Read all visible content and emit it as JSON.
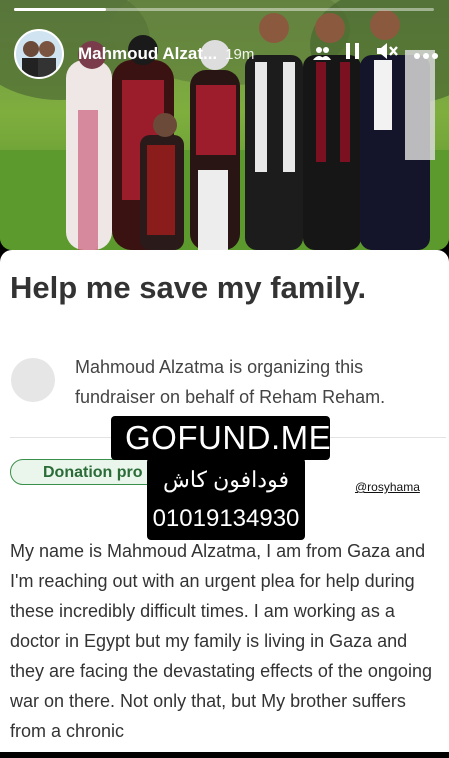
{
  "story_header": {
    "username": "Mahmoud Alzat...",
    "time": "19m",
    "icons": [
      "group-icon",
      "pause-icon",
      "mute-icon",
      "more-icon"
    ],
    "progress": 0.22
  },
  "fundraiser": {
    "title": "Help me save my family.",
    "organizer_text": "Mahmoud Alzatma is organizing this fundraiser on behalf of Reham Reham.",
    "badge": "Donation pro",
    "story_text": "My name is Mahmoud Alzatma, I am from Gaza and I'm reaching out with an urgent plea for help during these incredibly difficult times. I am working as a doctor in Egypt but my family is living in Gaza and they are facing the devastating effects of the ongoing war on there. Not only that, but My brother suffers from a chronic"
  },
  "stickers": {
    "link_label": "GOFUND.ME",
    "arabic_text": "فودافون كاش",
    "phone_number": "01019134930",
    "mention": "@rosyhama"
  },
  "colors": {
    "badge_green": "#3a8f4a",
    "link_gradient_start": "#f9a825",
    "link_gradient_end": "#d81b60"
  }
}
